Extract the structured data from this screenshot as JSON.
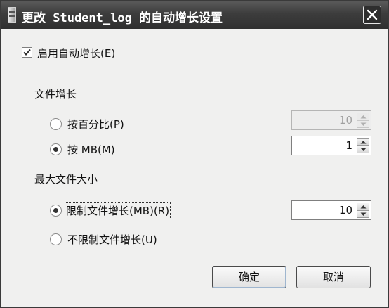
{
  "window": {
    "title": "更改 Student_log 的自动增长设置"
  },
  "enable_autogrowth": {
    "label": "启用自动增长(E)",
    "checked": true
  },
  "file_growth": {
    "heading": "文件增长",
    "by_percent": {
      "label": "按百分比(P)",
      "selected": false,
      "value": "10"
    },
    "by_mb": {
      "label": "按 MB(M)",
      "selected": true,
      "value": "1"
    }
  },
  "max_file_size": {
    "heading": "最大文件大小",
    "restricted": {
      "label": "限制文件增长(MB)(R)",
      "selected": true,
      "value": "10"
    },
    "unrestricted": {
      "label": "不限制文件增长(U)",
      "selected": false
    }
  },
  "buttons": {
    "ok": "确定",
    "cancel": "取消"
  }
}
